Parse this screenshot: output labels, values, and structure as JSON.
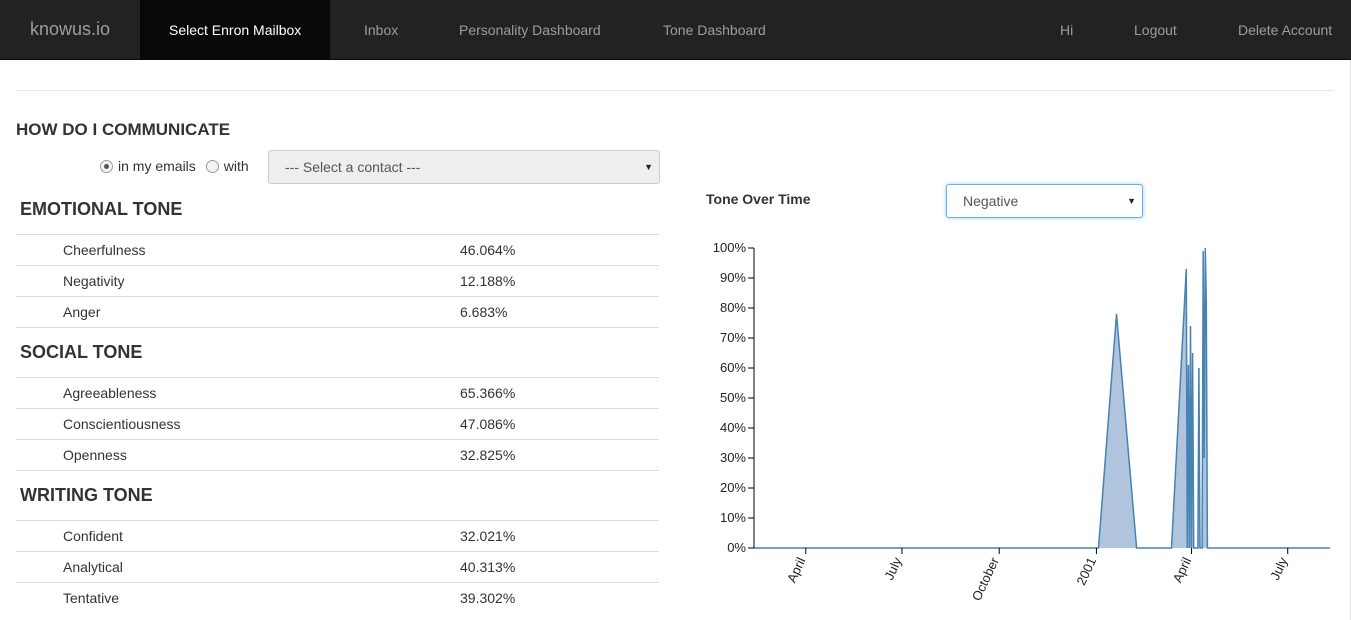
{
  "nav": {
    "brand": "knowus.io",
    "items": [
      "Select Enron Mailbox",
      "Inbox",
      "Personality Dashboard",
      "Tone Dashboard"
    ],
    "right": [
      "Hi",
      "Logout",
      "Delete Account"
    ]
  },
  "page": {
    "title": "TONE DASHBOARD"
  },
  "communicate": {
    "heading": "HOW DO I COMMUNICATE",
    "radio_emails": "in my emails",
    "radio_with": "with",
    "contact_placeholder": "--- Select a contact ---",
    "selected": "in my emails"
  },
  "sections": [
    {
      "heading": "EMOTIONAL TONE",
      "rows": [
        {
          "label": "Cheerfulness",
          "value": "46.064%"
        },
        {
          "label": "Negativity",
          "value": "12.188%"
        },
        {
          "label": "Anger",
          "value": "6.683%"
        }
      ]
    },
    {
      "heading": "SOCIAL TONE",
      "rows": [
        {
          "label": "Agreeableness",
          "value": "65.366%"
        },
        {
          "label": "Conscientiousness",
          "value": "47.086%"
        },
        {
          "label": "Openness",
          "value": "32.825%"
        }
      ]
    },
    {
      "heading": "WRITING TONE",
      "rows": [
        {
          "label": "Confident",
          "value": "32.021%"
        },
        {
          "label": "Analytical",
          "value": "40.313%"
        },
        {
          "label": "Tentative",
          "value": "39.302%"
        }
      ]
    }
  ],
  "tone_over_time": {
    "label": "Tone Over Time",
    "selected_tone": "Negative"
  },
  "chart_data": {
    "type": "area",
    "title": "",
    "xlabel": "",
    "ylabel": "",
    "ylim": [
      0,
      100
    ],
    "yticks": [
      "0%",
      "10%",
      "20%",
      "30%",
      "40%",
      "50%",
      "60%",
      "70%",
      "80%",
      "90%",
      "100%"
    ],
    "xticks": [
      {
        "label": "April",
        "date": "2000-04-01"
      },
      {
        "label": "July",
        "date": "2000-07-01"
      },
      {
        "label": "October",
        "date": "2000-10-01"
      },
      {
        "label": "2001",
        "date": "2001-01-01"
      },
      {
        "label": "April",
        "date": "2001-04-01"
      },
      {
        "label": "July",
        "date": "2001-07-01"
      }
    ],
    "x_range": [
      "2000-02-12",
      "2001-08-10"
    ],
    "grid": false,
    "color": "#4682b4",
    "fill": "#b0c4de",
    "points": [
      [
        "2000-02-12",
        0
      ],
      [
        "2001-01-03",
        0
      ],
      [
        "2001-01-20",
        78
      ],
      [
        "2001-02-08",
        0
      ],
      [
        "2001-03-13",
        0
      ],
      [
        "2001-03-27",
        93
      ],
      [
        "2001-03-28",
        0
      ],
      [
        "2001-03-29",
        61
      ],
      [
        "2001-03-30",
        0
      ],
      [
        "2001-03-31",
        74
      ],
      [
        "2001-04-01",
        0
      ],
      [
        "2001-04-02",
        65
      ],
      [
        "2001-04-03",
        0
      ],
      [
        "2001-04-07",
        0
      ],
      [
        "2001-04-08",
        60
      ],
      [
        "2001-04-09",
        0
      ],
      [
        "2001-04-11",
        0
      ],
      [
        "2001-04-12",
        99
      ],
      [
        "2001-04-13",
        30
      ],
      [
        "2001-04-14",
        100
      ],
      [
        "2001-04-15",
        82
      ],
      [
        "2001-04-16",
        0
      ],
      [
        "2001-08-10",
        0
      ]
    ]
  }
}
